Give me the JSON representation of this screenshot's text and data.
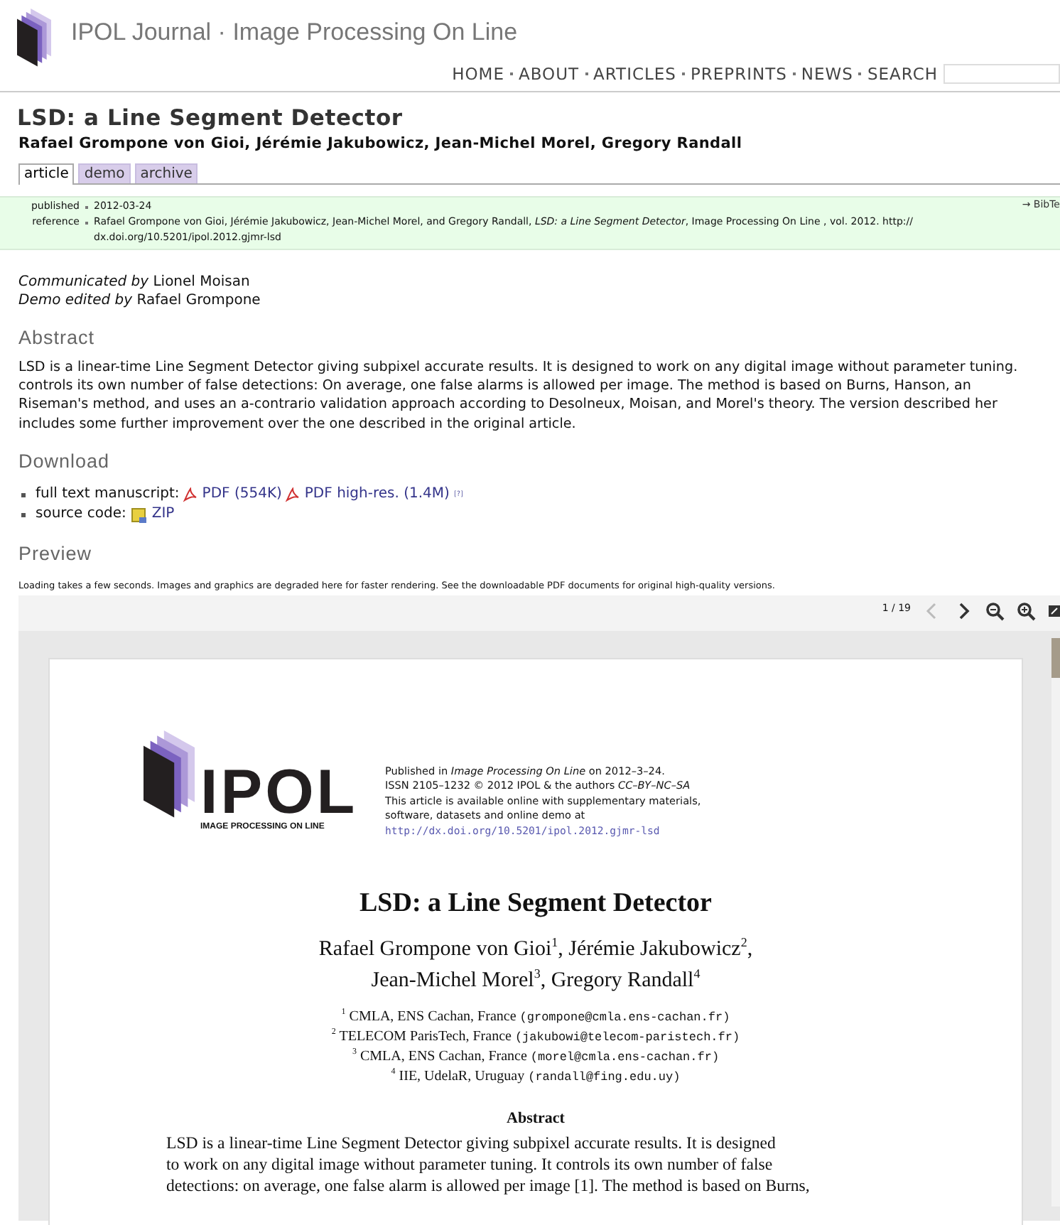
{
  "site": {
    "title": "IPOL Journal · Image Processing On Line"
  },
  "nav": {
    "items": [
      "HOME",
      "ABOUT",
      "ARTICLES",
      "PREPRINTS",
      "NEWS",
      "SEARCH"
    ]
  },
  "article": {
    "title": "LSD: a Line Segment Detector",
    "authors": "Rafael Grompone von Gioi, Jérémie Jakubowicz, Jean-Michel Morel, Gregory Randall"
  },
  "tabs": [
    {
      "label": "article",
      "selected": true
    },
    {
      "label": "demo",
      "selected": false
    },
    {
      "label": "archive",
      "selected": false
    }
  ],
  "info": {
    "bibtex": "→ BibTe",
    "rows": [
      {
        "label": "published",
        "lines": [
          "2012-03-24"
        ]
      },
      {
        "label": "reference",
        "lines": [
          "Rafael Grompone von Gioi, Jérémie Jakubowicz, Jean-Michel Morel, and Gregory Randall, *LSD: a Line Segment Detector*, Image Processing On Line , vol. 2012. http://",
          "dx.doi.org/10.5201/ipol.2012.gjmr-lsd"
        ]
      }
    ]
  },
  "credits": [
    {
      "role": "Communicated by",
      "name": "Lionel Moisan"
    },
    {
      "role": "Demo edited by",
      "name": "Rafael Grompone"
    }
  ],
  "abstract": {
    "heading": "Abstract",
    "lines": [
      "LSD is a linear-time Line Segment Detector giving subpixel accurate results. It is designed to work on any digital image without parameter tuning.",
      "controls its own number of false detections: On average, one false alarms is allowed per image. The method is based on Burns, Hanson, an",
      "Riseman's method, and uses an a-contrario validation approach according to Desolneux, Moisan, and Morel's theory. The version described her",
      "includes some further improvement over the one described in the original article."
    ]
  },
  "download": {
    "heading": "Download",
    "items": [
      {
        "label": "full text manuscript:",
        "links": [
          {
            "kind": "pdf",
            "text": "PDF (554K)"
          },
          {
            "kind": "pdf",
            "text": "PDF high-res. (1.4M)",
            "note": "[?]"
          }
        ]
      },
      {
        "label": "source code:",
        "links": [
          {
            "kind": "zip",
            "text": "ZIP"
          }
        ]
      }
    ]
  },
  "preview": {
    "heading": "Preview",
    "note": "Loading takes a few seconds. Images and graphics are degraded here for faster rendering. See the downloadable PDF documents for original high-quality versions.",
    "page_counter": "1 / 19",
    "page": {
      "logo_text": "IPOL",
      "logo_caption": "IMAGE PROCESSING ON LINE",
      "pub_lines": [
        "Published in *Image Processing On Line* on 2012–3–24.",
        "ISSN 2105–1232 © 2012 IPOL & the authors *CC–BY–NC–SA*",
        "This article is available online with supplementary materials,",
        "software, datasets and online demo at",
        "http://dx.doi.org/10.5201/ipol.2012.gjmr-lsd"
      ],
      "title": "LSD: a Line Segment Detector",
      "author_lines": [
        "Rafael Grompone von Gioi$^{1}$, Jérémie Jakubowicz$^{2}$,",
        "Jean-Michel Morel$^{3}$, Gregory Randall$^{4}$"
      ],
      "affiliations": [
        {
          "mark": "1",
          "place": "CMLA, ENS Cachan, France",
          "email": "(grompone@cmla.ens-cachan.fr)"
        },
        {
          "mark": "2",
          "place": "TELECOM ParisTech, France",
          "email": "(jakubowi@telecom-paristech.fr)"
        },
        {
          "mark": "3",
          "place": "CMLA, ENS Cachan, France",
          "email": "(morel@cmla.ens-cachan.fr)"
        },
        {
          "mark": "4",
          "place": "IIE, UdelaR, Uruguay",
          "email": "(randall@fing.edu.uy)"
        }
      ],
      "abstract_heading": "Abstract",
      "abstract_lines": [
        "LSD is a linear-time Line Segment Detector giving subpixel accurate results. It is designed",
        "to work on any digital image without parameter tuning. It controls its own number of false",
        "detections: on average, one false alarm is allowed per image [1]. The method is based on Burns,"
      ]
    }
  }
}
